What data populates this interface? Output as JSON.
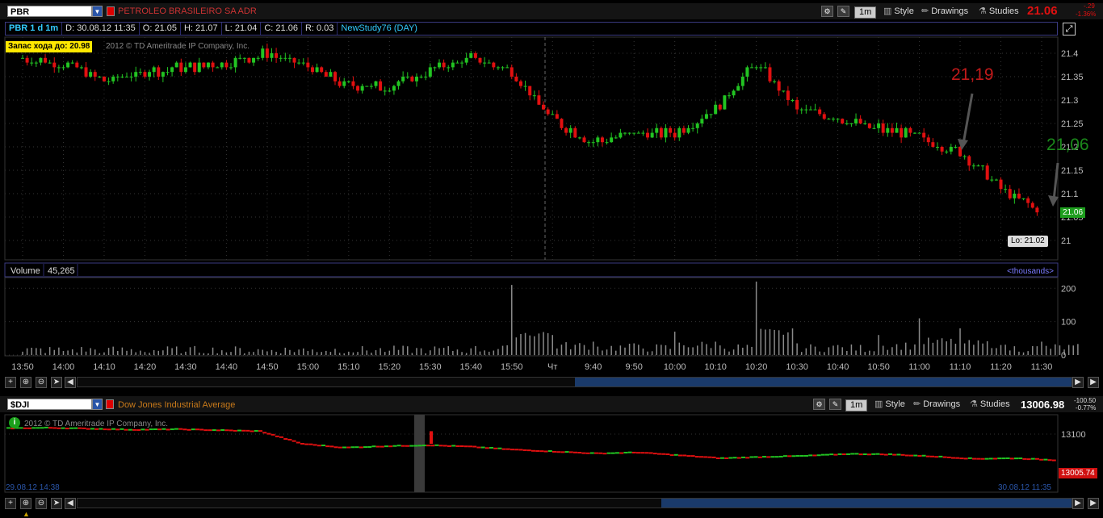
{
  "top_chart": {
    "symbol": "PBR",
    "description": "PETROLEO BRASILEIRO SA ADR",
    "timeframe_button": "1m",
    "style_label": "Style",
    "drawings_label": "Drawings",
    "studies_label": "Studies",
    "last_price": "21.06",
    "net_change": "-.29",
    "pct_change": "-1.36%",
    "info": {
      "title": "PBR 1 d 1m",
      "date": "D: 30.08.12 11:35",
      "open": "O: 21.05",
      "high": "H: 21.07",
      "low": "L: 21.04",
      "close": "C: 21.06",
      "range": "R: 0.03",
      "study": "NewStudy76 (DAY)"
    },
    "stop_label": "Запас хода до: 20.98",
    "copyright": "2012 © TD Ameritrade IP Company, Inc.",
    "annotation_1": "21,19",
    "annotation_2": "21,06",
    "price_tag": "21.06",
    "low_label": "Lo: 21.02",
    "price_axis": [
      "21.4",
      "21.35",
      "21.3",
      "21.25",
      "21.2",
      "21.15",
      "21.1",
      "21.05",
      "21"
    ],
    "volume_label": "Volume",
    "volume_value": "45,265",
    "volume_units": "<thousands>",
    "volume_axis": [
      "200",
      "100",
      "0"
    ],
    "time_axis": [
      "13:50",
      "14:00",
      "14:10",
      "14:20",
      "14:30",
      "14:40",
      "14:50",
      "15:00",
      "15:10",
      "15:20",
      "15:30",
      "15:40",
      "15:50",
      "Чт",
      "9:40",
      "9:50",
      "10:00",
      "10:10",
      "10:20",
      "10:30",
      "10:40",
      "10:50",
      "11:00",
      "11:10",
      "11:20",
      "11:30"
    ]
  },
  "bottom_chart": {
    "symbol": "$DJI",
    "description": "Dow Jones Industrial Average",
    "timeframe_button": "1m",
    "style_label": "Style",
    "drawings_label": "Drawings",
    "studies_label": "Studies",
    "last_price": "13006.98",
    "net_change": "-100.50",
    "pct_change": "-0.77%",
    "copyright": "2012 © TD Ameritrade IP Company, Inc.",
    "price_axis": [
      "13100"
    ],
    "price_tag": "13005.74",
    "start_date": "29.08.12 14:38",
    "end_date": "30.08.12 11:35"
  },
  "colors": {
    "up": "#22c422",
    "down": "#e01010",
    "grid": "#333333",
    "accent": "#2a55a8"
  },
  "chart_data": [
    {
      "type": "candlestick",
      "title": "PBR 1 d 1m",
      "ylim": [
        20.97,
        21.43
      ],
      "x": [
        "13:50",
        "14:00",
        "14:10",
        "14:20",
        "14:30",
        "14:40",
        "14:50",
        "15:00",
        "15:10",
        "15:20",
        "15:30",
        "15:40",
        "15:50",
        "Чт",
        "9:40",
        "9:50",
        "10:00",
        "10:10",
        "10:20",
        "10:30",
        "10:40",
        "10:50",
        "11:00",
        "11:10",
        "11:20",
        "11:30"
      ],
      "series": [
        {
          "name": "PBR",
          "values": [
            21.39,
            21.38,
            21.34,
            21.36,
            21.37,
            21.38,
            21.4,
            21.37,
            21.33,
            21.33,
            21.36,
            21.39,
            21.36,
            21.26,
            21.21,
            21.23,
            21.23,
            21.28,
            21.38,
            21.28,
            21.26,
            21.24,
            21.22,
            21.19,
            21.11,
            21.06
          ]
        }
      ],
      "annotations": [
        "21,19",
        "21,06",
        "Lo: 21.02"
      ]
    },
    {
      "type": "bar",
      "title": "Volume",
      "ylim": [
        0,
        220
      ],
      "categories": [
        "13:50",
        "14:00",
        "14:10",
        "14:20",
        "14:30",
        "14:40",
        "14:50",
        "15:00",
        "15:10",
        "15:20",
        "15:30",
        "15:40",
        "15:50",
        "Чт",
        "9:40",
        "9:50",
        "10:00",
        "10:10",
        "10:20",
        "10:30",
        "10:40",
        "10:50",
        "11:00",
        "11:10",
        "11:20",
        "11:30"
      ],
      "values": [
        10,
        12,
        8,
        9,
        10,
        8,
        11,
        12,
        10,
        13,
        14,
        20,
        210,
        60,
        40,
        35,
        70,
        40,
        220,
        35,
        30,
        60,
        110,
        80,
        30,
        40
      ]
    },
    {
      "type": "line",
      "title": "Dow Jones Industrial Average",
      "series": [
        {
          "name": "$DJI",
          "values": [
            13112,
            13113,
            13111,
            13109,
            13110,
            13108,
            13106,
            13080,
            13072,
            13075,
            13077,
            13074,
            13068,
            13064,
            13060,
            13062,
            13056,
            13050,
            13053,
            13055,
            13059,
            13058,
            13054,
            13049,
            13050,
            13046
          ]
        }
      ]
    }
  ]
}
